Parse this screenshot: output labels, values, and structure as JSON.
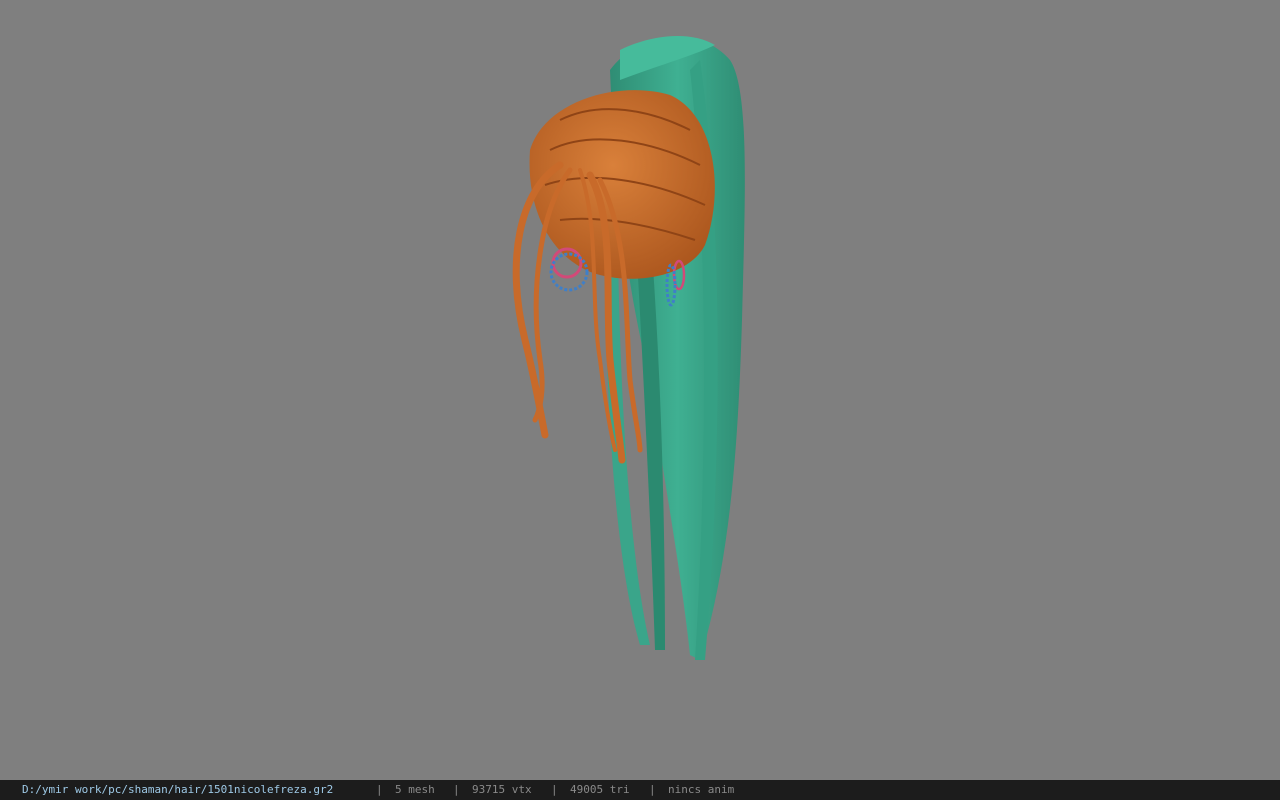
{
  "window": {
    "background_color": "#7f7f7f"
  },
  "model": {
    "hair_primary_color": "#c86a2a",
    "hair_secondary_color": "#3aa58a",
    "ring_colors": [
      "#d24a78",
      "#3f7fc8"
    ]
  },
  "statusbar": {
    "path": "D:/ymir work/pc/shaman/hair/1501nicolefreza.gr2",
    "separator": "|",
    "mesh": "5 mesh",
    "vertices": "93715 vtx",
    "triangles": "49005 tri",
    "anim": "nincs anim"
  }
}
